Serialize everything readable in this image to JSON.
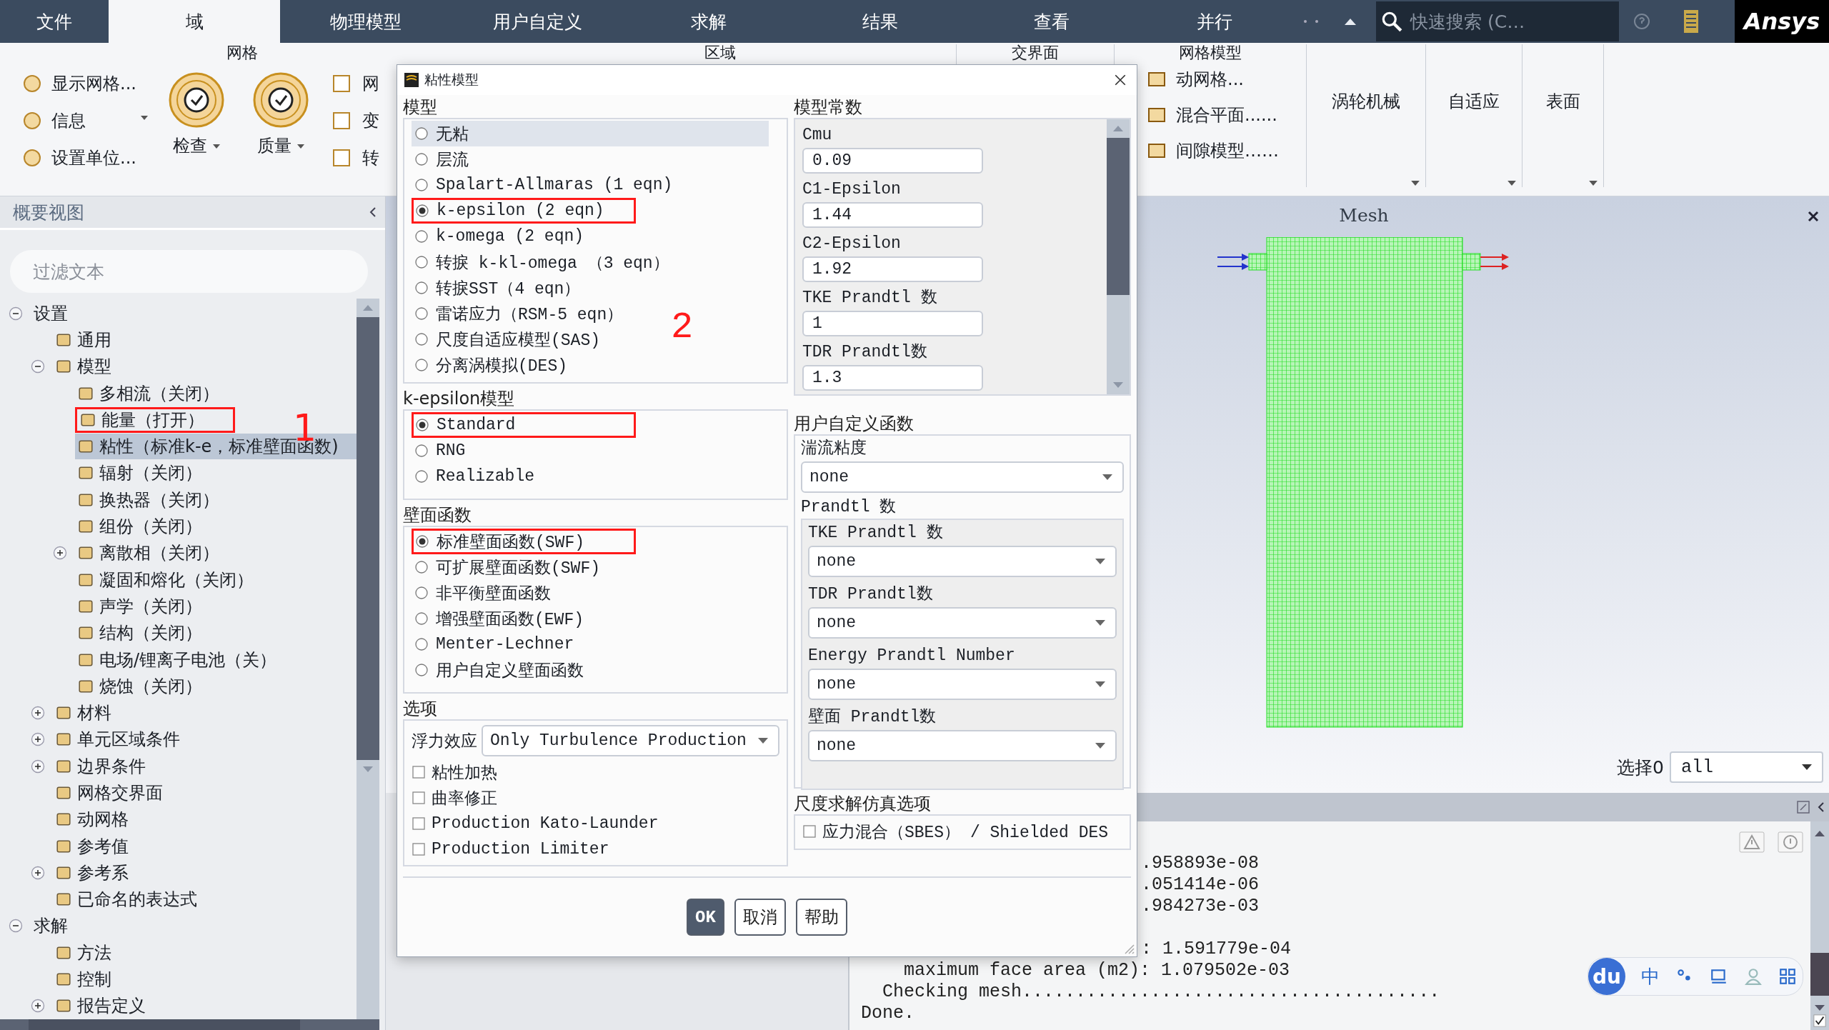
{
  "top_tabs": [
    {
      "label": "文件",
      "selected": false
    },
    {
      "label": "域",
      "selected": true
    },
    {
      "label": "物理模型",
      "selected": false
    },
    {
      "label": "用户自定义",
      "selected": false
    },
    {
      "label": "求解",
      "selected": false
    },
    {
      "label": "结果",
      "selected": false
    },
    {
      "label": "查看",
      "selected": false
    },
    {
      "label": "并行",
      "selected": false
    }
  ],
  "top_bar": {
    "search_placeholder": "快速搜索 (C…",
    "logo": "Ansys"
  },
  "ribbon": {
    "mesh_group": {
      "title": "网格",
      "small_buttons": [
        "显示网格...",
        "信息",
        "设置单位..."
      ],
      "large_buttons": [
        "检查",
        "质量"
      ],
      "cut_buttons": [
        "网",
        "变",
        "转"
      ]
    },
    "zone_group": {
      "title": "区域"
    },
    "interface_group": {
      "title": "交界面"
    },
    "mesh_models_group": {
      "title": "网格模型",
      "buttons": [
        "动网格...",
        "混合平面......",
        "间隙模型……"
      ]
    },
    "menus": [
      "涡轮机械",
      "自适应",
      "表面"
    ]
  },
  "outline": {
    "title": "概要视图",
    "filter_placeholder": "过滤文本",
    "annotation": "1",
    "tree": [
      {
        "label": "设置",
        "expanded": true,
        "selected": false,
        "highlighted": false,
        "children": [
          {
            "label": "通用",
            "selected": false,
            "highlighted": false
          },
          {
            "label": "模型",
            "expanded": true,
            "selected": false,
            "highlighted": false,
            "children": [
              {
                "label": "多相流（关闭）",
                "selected": false,
                "highlighted": false
              },
              {
                "label": "能量（打开）",
                "selected": false,
                "highlighted": true
              },
              {
                "label": "粘性（标准k-e，标准壁面函数)",
                "selected": true,
                "highlighted": false
              },
              {
                "label": "辐射（关闭）",
                "selected": false,
                "highlighted": false
              },
              {
                "label": "换热器（关闭）",
                "selected": false,
                "highlighted": false
              },
              {
                "label": "组份（关闭）",
                "selected": false,
                "highlighted": false
              },
              {
                "label": "离散相（关闭）",
                "expanded": false,
                "selected": false,
                "highlighted": false
              },
              {
                "label": "凝固和熔化（关闭）",
                "selected": false,
                "highlighted": false
              },
              {
                "label": "声学（关闭）",
                "selected": false,
                "highlighted": false
              },
              {
                "label": "结构（关闭）",
                "selected": false,
                "highlighted": false
              },
              {
                "label": "电场/锂离子电池（关）",
                "selected": false,
                "highlighted": false
              },
              {
                "label": "烧蚀（关闭）",
                "selected": false,
                "highlighted": false
              }
            ]
          },
          {
            "label": "材料",
            "expanded": false,
            "selected": false,
            "highlighted": false
          },
          {
            "label": "单元区域条件",
            "expanded": false,
            "selected": false,
            "highlighted": false
          },
          {
            "label": "边界条件",
            "expanded": false,
            "selected": false,
            "highlighted": false
          },
          {
            "label": "网格交界面",
            "selected": false,
            "highlighted": false
          },
          {
            "label": "动网格",
            "selected": false,
            "highlighted": false
          },
          {
            "label": "参考值",
            "selected": false,
            "highlighted": false
          },
          {
            "label": "参考系",
            "expanded": false,
            "selected": false,
            "highlighted": false
          },
          {
            "label": "已命名的表达式",
            "selected": false,
            "highlighted": false
          }
        ]
      },
      {
        "label": "求解",
        "expanded": true,
        "selected": false,
        "highlighted": false,
        "children": [
          {
            "label": "方法",
            "selected": false,
            "highlighted": false
          },
          {
            "label": "控制",
            "selected": false,
            "highlighted": false
          },
          {
            "label": "报告定义",
            "expanded": false,
            "selected": false,
            "highlighted": false
          }
        ]
      }
    ]
  },
  "dialog": {
    "title": "粘性模型",
    "annotation": "2",
    "model": {
      "title": "模型",
      "options": [
        {
          "label": "无粘",
          "selected": false,
          "focused": true,
          "highlighted": false
        },
        {
          "label": "层流",
          "selected": false,
          "focused": false,
          "highlighted": false
        },
        {
          "label": "Spalart-Allmaras (1 eqn)",
          "selected": false,
          "focused": false,
          "highlighted": false
        },
        {
          "label": "k-epsilon (2 eqn)",
          "selected": true,
          "focused": false,
          "highlighted": true
        },
        {
          "label": "k-omega (2 eqn)",
          "selected": false,
          "focused": false,
          "highlighted": false
        },
        {
          "label": "转捩 k-kl-omega （3 eqn）",
          "selected": false,
          "focused": false,
          "highlighted": false
        },
        {
          "label": "转捩SST（4 eqn）",
          "selected": false,
          "focused": false,
          "highlighted": false
        },
        {
          "label": "雷诺应力（RSM-5 eqn）",
          "selected": false,
          "focused": false,
          "highlighted": false
        },
        {
          "label": "尺度自适应模型(SAS)",
          "selected": false,
          "focused": false,
          "highlighted": false
        },
        {
          "label": "分离涡模拟(DES)",
          "selected": false,
          "focused": false,
          "highlighted": false
        }
      ]
    },
    "k_epsilon": {
      "title": "k-epsilon模型",
      "options": [
        {
          "label": "Standard",
          "selected": true,
          "focused": false,
          "highlighted": true
        },
        {
          "label": "RNG",
          "selected": false,
          "focused": false,
          "highlighted": false
        },
        {
          "label": "Realizable",
          "selected": false,
          "focused": false,
          "highlighted": false
        }
      ]
    },
    "wall": {
      "title": "壁面函数",
      "options": [
        {
          "label": "标准壁面函数(SWF)",
          "selected": true,
          "focused": false,
          "highlighted": true
        },
        {
          "label": "可扩展壁面函数(SWF)",
          "selected": false,
          "focused": false,
          "highlighted": false
        },
        {
          "label": "非平衡壁面函数",
          "selected": false,
          "focused": false,
          "highlighted": false
        },
        {
          "label": "增强壁面函数(EWF)",
          "selected": false,
          "focused": false,
          "highlighted": false
        },
        {
          "label": "Menter-Lechner",
          "selected": false,
          "focused": false,
          "highlighted": false
        },
        {
          "label": "用户自定义壁面函数",
          "selected": false,
          "focused": false,
          "highlighted": false
        }
      ]
    },
    "options": {
      "title": "选项",
      "buoyancy": {
        "label": "浮力效应",
        "value": "Only Turbulence Production"
      },
      "checks": [
        {
          "label": "粘性加热",
          "checked": false
        },
        {
          "label": "曲率修正",
          "checked": false
        },
        {
          "label": "Production Kato-Launder",
          "checked": false
        },
        {
          "label": "Production Limiter",
          "checked": false
        }
      ]
    },
    "constants": {
      "title": "模型常数",
      "fields": [
        {
          "label": "Cmu",
          "value": "0.09"
        },
        {
          "label": "C1-Epsilon",
          "value": "1.44"
        },
        {
          "label": "C2-Epsilon",
          "value": "1.92"
        },
        {
          "label": "TKE Prandtl 数",
          "value": "1"
        },
        {
          "label": "TDR Prandtl数",
          "value": "1.3"
        }
      ]
    },
    "udf": {
      "title": "用户自定义函数",
      "turbulent_viscosity": {
        "label": "湍流粘度",
        "value": "none"
      },
      "prandtl": {
        "title": "Prandtl 数",
        "fields": [
          {
            "label": "TKE Prandtl 数",
            "value": "none"
          },
          {
            "label": "TDR Prandtl数",
            "value": "none"
          },
          {
            "label": "Energy Prandtl Number",
            "value": "none"
          },
          {
            "label": "壁面 Prandtl数",
            "value": "none"
          }
        ]
      }
    },
    "srs": {
      "title": "尺度求解仿真选项",
      "check": {
        "label": "应力混合（SBES） / Shielded DES",
        "checked": false
      }
    },
    "buttons": [
      {
        "label": "OK",
        "kind": "primary"
      },
      {
        "label": "取消",
        "kind": "normal"
      },
      {
        "label": "帮助",
        "kind": "normal"
      }
    ]
  },
  "graphics": {
    "title": "Mesh",
    "selector": {
      "label": "选择0",
      "value": "all"
    }
  },
  "console": {
    "lines": [
      {
        "text": ".958893e-08",
        "kind": "clipped"
      },
      {
        "text": ".051414e-06",
        "kind": "clipped"
      },
      {
        "text": ".984273e-03",
        "kind": "clipped"
      },
      {
        "text": ": 1.591779e-04",
        "kind": "clipped"
      },
      {
        "text": "    maximum face area (m2): 1.079502e-03",
        "kind": "full"
      },
      {
        "text": "  Checking mesh.......................................",
        "kind": "full"
      },
      {
        "text": "Done.",
        "kind": "full"
      }
    ]
  },
  "ime_bar": {
    "logo": "du",
    "mode": "中"
  }
}
